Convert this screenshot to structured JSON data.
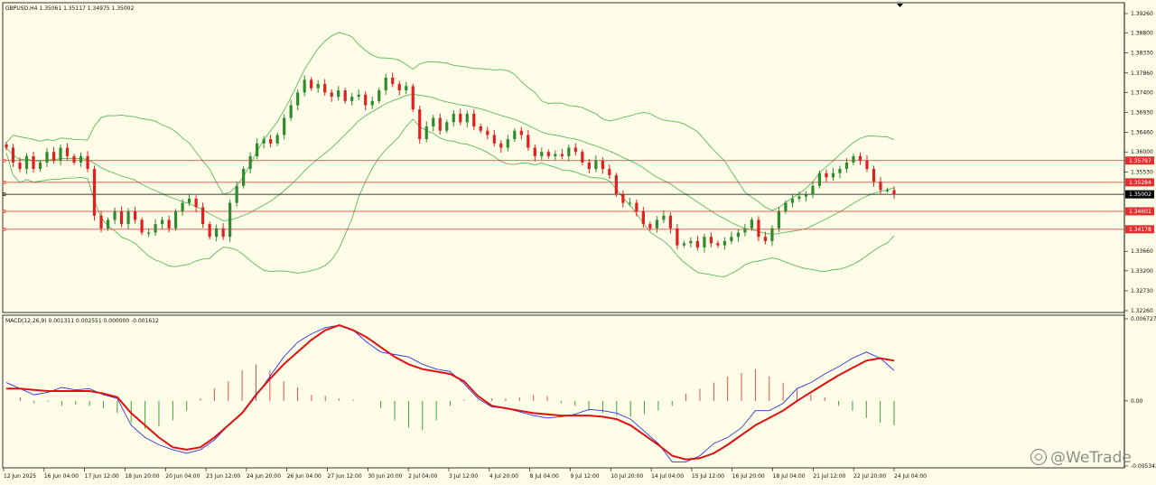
{
  "main_panel": {
    "header": "GBPUSD,H4  1.35061 1.35117 1.34975 1.35002"
  },
  "macd_panel": {
    "header": "MACD(12,26,9) 0.001311 0.002551 0.000000 -0.001612"
  },
  "price_axis": {
    "ticks": [
      "1.39260",
      "1.38800",
      "1.38330",
      "1.37860",
      "1.37400",
      "1.36930",
      "1.36460",
      "1.36000",
      "1.35530",
      "1.33660",
      "1.33200",
      "1.32730",
      "1.32260"
    ]
  },
  "macd_axis": {
    "ticks": [
      "0.006727",
      "0.00",
      "-0.005342"
    ]
  },
  "levels": [
    {
      "label": "1.35797",
      "value": 1.35797,
      "color": "#e03030"
    },
    {
      "label": "1.35284",
      "value": 1.35284,
      "color": "#e03030"
    },
    {
      "label": "1.35002",
      "value": 1.35002,
      "color": "#000000"
    },
    {
      "label": "1.34601",
      "value": 1.34601,
      "color": "#e03030"
    },
    {
      "label": "1.34178",
      "value": 1.34178,
      "color": "#e03030"
    }
  ],
  "time_axis": {
    "ticks": [
      "12 Jun 2025",
      "16 Jun 04:00",
      "17 Jun 12:00",
      "18 Jun 20:00",
      "20 Jun 04:00",
      "23 Jun 12:00",
      "24 Jun 20:00",
      "26 Jun 04:00",
      "27 Jun 12:00",
      "30 Jun 20:00",
      "2 Jul 04:00",
      "3 Jul 12:00",
      "4 Jul 20:00",
      "8 Jul 04:00",
      "9 Jul 12:00",
      "10 Jul 20:00",
      "14 Jul 04:00",
      "15 Jul 12:00",
      "16 Jul 20:00",
      "18 Jul 04:00",
      "21 Jul 12:00",
      "22 Jul 20:00",
      "24 Jul 04:00"
    ]
  },
  "watermark": {
    "text": "@WeTrade"
  },
  "colors": {
    "background": "#fdfde8",
    "bull": "#2e8b2e",
    "bear": "#e02020",
    "bands": "#5cb85c",
    "macd_line": "#3333dd",
    "signal_line": "#e01010",
    "hist_pos": "#e05050",
    "hist_neg": "#40a040"
  },
  "chart_data": [
    {
      "type": "candlestick",
      "title": "GBPUSD,H4",
      "ylim": [
        1.3226,
        1.3926
      ],
      "closes": [
        1.361,
        1.3575,
        1.356,
        1.359,
        1.356,
        1.3575,
        1.36,
        1.358,
        1.361,
        1.359,
        1.3575,
        1.359,
        1.356,
        1.345,
        1.342,
        1.344,
        1.346,
        1.343,
        1.346,
        1.344,
        1.341,
        1.341,
        1.343,
        1.344,
        1.342,
        1.346,
        1.348,
        1.349,
        1.347,
        1.343,
        1.34,
        1.342,
        1.34,
        1.348,
        1.352,
        1.356,
        1.359,
        1.362,
        1.363,
        1.362,
        1.364,
        1.368,
        1.371,
        1.374,
        1.377,
        1.375,
        1.376,
        1.374,
        1.373,
        1.3745,
        1.372,
        1.373,
        1.3735,
        1.371,
        1.372,
        1.3745,
        1.3775,
        1.376,
        1.3745,
        1.3755,
        1.37,
        1.363,
        1.366,
        1.368,
        1.365,
        1.367,
        1.369,
        1.367,
        1.369,
        1.366,
        1.365,
        1.364,
        1.362,
        1.361,
        1.363,
        1.365,
        1.364,
        1.361,
        1.359,
        1.36,
        1.359,
        1.3595,
        1.359,
        1.361,
        1.36,
        1.3575,
        1.356,
        1.358,
        1.356,
        1.3545,
        1.35,
        1.348,
        1.348,
        1.346,
        1.343,
        1.342,
        1.344,
        1.345,
        1.342,
        1.338,
        1.3385,
        1.339,
        1.3375,
        1.34,
        1.3385,
        1.338,
        1.339,
        1.34,
        1.341,
        1.342,
        1.344,
        1.34,
        1.339,
        1.342,
        1.346,
        1.348,
        1.349,
        1.3495,
        1.35,
        1.352,
        1.355,
        1.354,
        1.355,
        1.356,
        1.3575,
        1.359,
        1.358,
        1.356,
        1.353,
        1.351,
        1.351,
        1.35
      ]
    },
    {
      "type": "line",
      "title": "MACD(12,26,9)",
      "ylim": [
        -0.005342,
        0.006727
      ],
      "series": [
        {
          "name": "MACD",
          "values": [
            0.0015,
            0.001,
            0.0005,
            0.0007,
            0.0011,
            0.0009,
            0.001,
            0.0005,
            0.0002,
            -0.002,
            -0.003,
            -0.0036,
            -0.004,
            -0.0043,
            -0.004,
            -0.0032,
            -0.002,
            -0.001,
            0.0004,
            0.002,
            0.0036,
            0.0048,
            0.0055,
            0.006,
            0.0062,
            0.0058,
            0.0048,
            0.004,
            0.0038,
            0.0036,
            0.003,
            0.0026,
            0.0024,
            0.0014,
            0.0002,
            -0.0005,
            -0.0006,
            -0.0009,
            -0.0012,
            -0.0014,
            -0.0013,
            -0.0011,
            -0.0007,
            -0.0008,
            -0.001,
            -0.0015,
            -0.0025,
            -0.0035,
            -0.005,
            -0.005,
            -0.0045,
            -0.0035,
            -0.003,
            -0.0022,
            -0.0008,
            -0.0008,
            -0.0002,
            0.001,
            0.0015,
            0.0022,
            0.0028,
            0.0035,
            0.004,
            0.0035,
            0.0025
          ]
        },
        {
          "name": "Signal",
          "values": [
            0.001,
            0.001,
            0.0009,
            0.0008,
            0.0008,
            0.0008,
            0.0008,
            0.0006,
            0.0003,
            -0.001,
            -0.002,
            -0.003,
            -0.0038,
            -0.004,
            -0.0038,
            -0.003,
            -0.002,
            -0.001,
            0.0005,
            0.0018,
            0.003,
            0.004,
            0.005,
            0.0058,
            0.0062,
            0.0058,
            0.0052,
            0.0044,
            0.0036,
            0.003,
            0.0026,
            0.0024,
            0.0022,
            0.0016,
            0.0004,
            -0.0004,
            -0.0006,
            -0.0008,
            -0.001,
            -0.0011,
            -0.0012,
            -0.0012,
            -0.0012,
            -0.0013,
            -0.0015,
            -0.002,
            -0.0028,
            -0.0036,
            -0.0045,
            -0.0048,
            -0.0047,
            -0.0043,
            -0.0036,
            -0.0028,
            -0.002,
            -0.0014,
            -0.0008,
            0.0,
            0.0007,
            0.0014,
            0.0021,
            0.0027,
            0.0033,
            0.0035,
            0.0033
          ]
        }
      ],
      "histogram": [
        0.0,
        0.0003,
        -0.0002,
        -0.0001,
        -0.0004,
        -0.0003,
        -0.0004,
        -0.0006,
        -0.001,
        -0.0018,
        -0.0023,
        -0.0021,
        -0.0016,
        -0.0008,
        0.0002,
        0.001,
        0.0016,
        0.0025,
        0.003,
        0.0025,
        0.0016,
        0.0011,
        0.0005,
        0.0004,
        0.0002,
        0.0001,
        0.0,
        -0.0006,
        -0.0016,
        -0.0022,
        -0.0024,
        -0.0016,
        -0.0004,
        0.0001,
        0.0001,
        0.0002,
        0.0002,
        0.0003,
        0.0005,
        0.0004,
        -0.0002,
        -0.0004,
        -0.0008,
        -0.001,
        -0.0012,
        -0.0013,
        -0.0011,
        -0.0008,
        -0.0004,
        0.0006,
        0.001,
        0.0015,
        0.002,
        0.0023,
        0.0026,
        0.002,
        0.0015,
        0.001,
        0.0005,
        0.0003,
        -0.0004,
        -0.0008,
        -0.0014,
        -0.0018,
        -0.002
      ]
    }
  ]
}
